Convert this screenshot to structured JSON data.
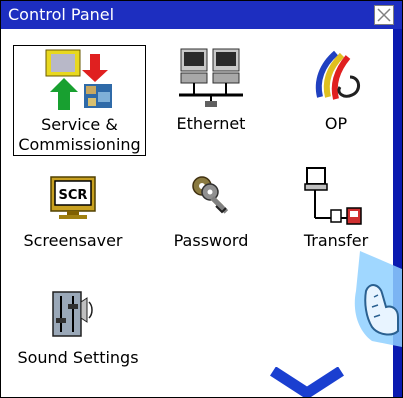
{
  "window": {
    "title": "Control Panel",
    "close_icon": "close-x-icon"
  },
  "items": [
    {
      "id": "service",
      "label_line1": "Service &",
      "label_line2": "Commissioning",
      "icon": "service-commissioning-icon",
      "selected": true
    },
    {
      "id": "ethernet",
      "label": "Ethernet",
      "icon": "ethernet-icon"
    },
    {
      "id": "op",
      "label": "OP",
      "icon": "op-icon"
    },
    {
      "id": "screensaver",
      "label": "Screensaver",
      "icon": "screensaver-icon",
      "icon_text": "SCR"
    },
    {
      "id": "password",
      "label": "Password",
      "icon": "password-keys-icon"
    },
    {
      "id": "transfer",
      "label": "Transfer",
      "icon": "transfer-icon"
    },
    {
      "id": "sound",
      "label": "Sound Settings",
      "icon": "sound-settings-icon"
    }
  ],
  "overlays": {
    "hand_cursor": "touch-hand-icon",
    "chevron": "chevron-down-icon"
  },
  "colors": {
    "titlebar": "#1d2ec0",
    "accent_blue": "#1a3fd0"
  }
}
